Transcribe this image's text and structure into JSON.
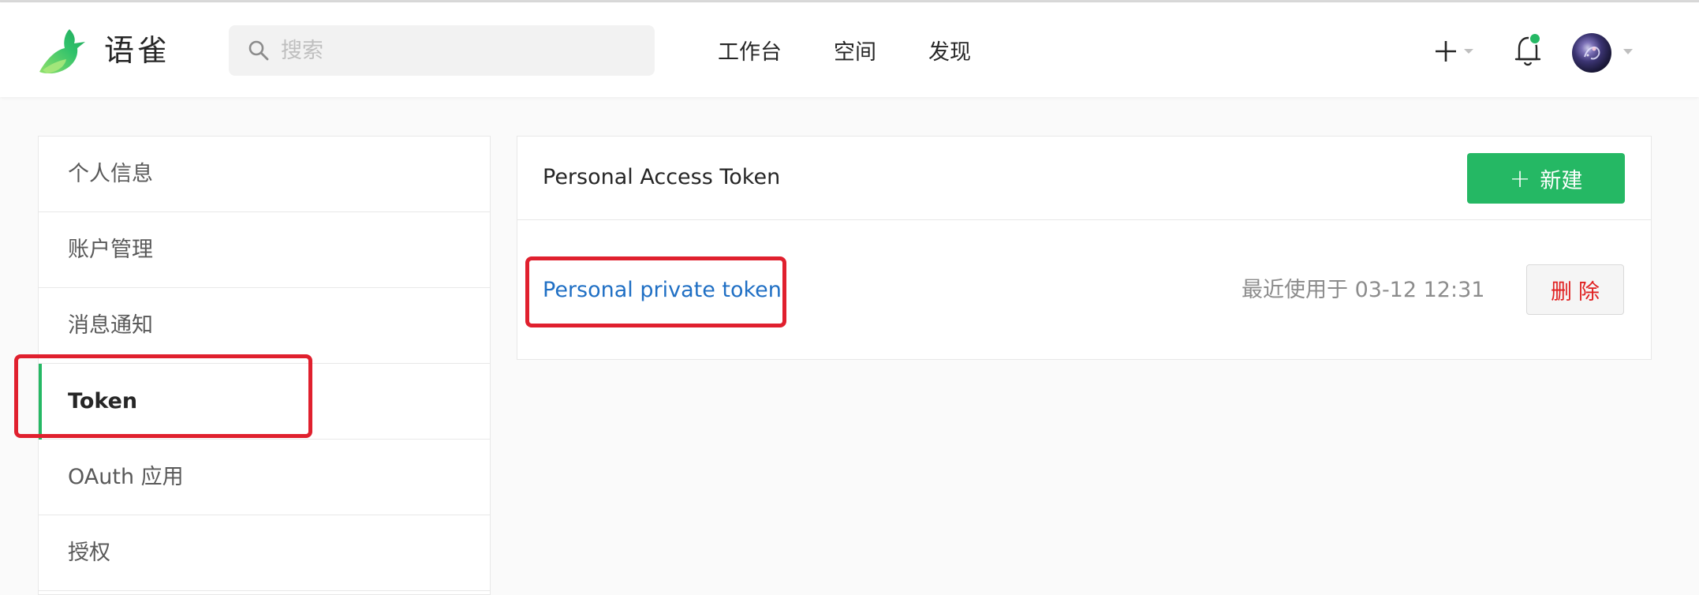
{
  "app": {
    "brand": "语雀",
    "logo_icon": "yuque-bird-logo",
    "accent_color": "#25b864"
  },
  "search": {
    "placeholder": "搜索",
    "value": ""
  },
  "nav": {
    "items": [
      {
        "label": "工作台"
      },
      {
        "label": "空间"
      },
      {
        "label": "发现"
      }
    ]
  },
  "header_actions": {
    "create_icon": "plus-icon",
    "notification_icon": "bell-icon",
    "notification_dot_color": "#25b864",
    "avatar_icon": "user-avatar"
  },
  "sidebar": {
    "items": [
      {
        "label": "个人信息"
      },
      {
        "label": "账户管理"
      },
      {
        "label": "消息通知"
      },
      {
        "label": "Token",
        "active": true
      },
      {
        "label": "OAuth 应用"
      },
      {
        "label": "授权"
      }
    ]
  },
  "panel": {
    "title": "Personal Access Token",
    "new_button": {
      "icon": "+",
      "label": "新建"
    },
    "tokens": [
      {
        "name": "Personal private token",
        "last_used": "最近使用于 03-12 12:31",
        "delete_label": "删除"
      }
    ]
  },
  "annotations": {
    "highlight_color": "#e0202e"
  }
}
